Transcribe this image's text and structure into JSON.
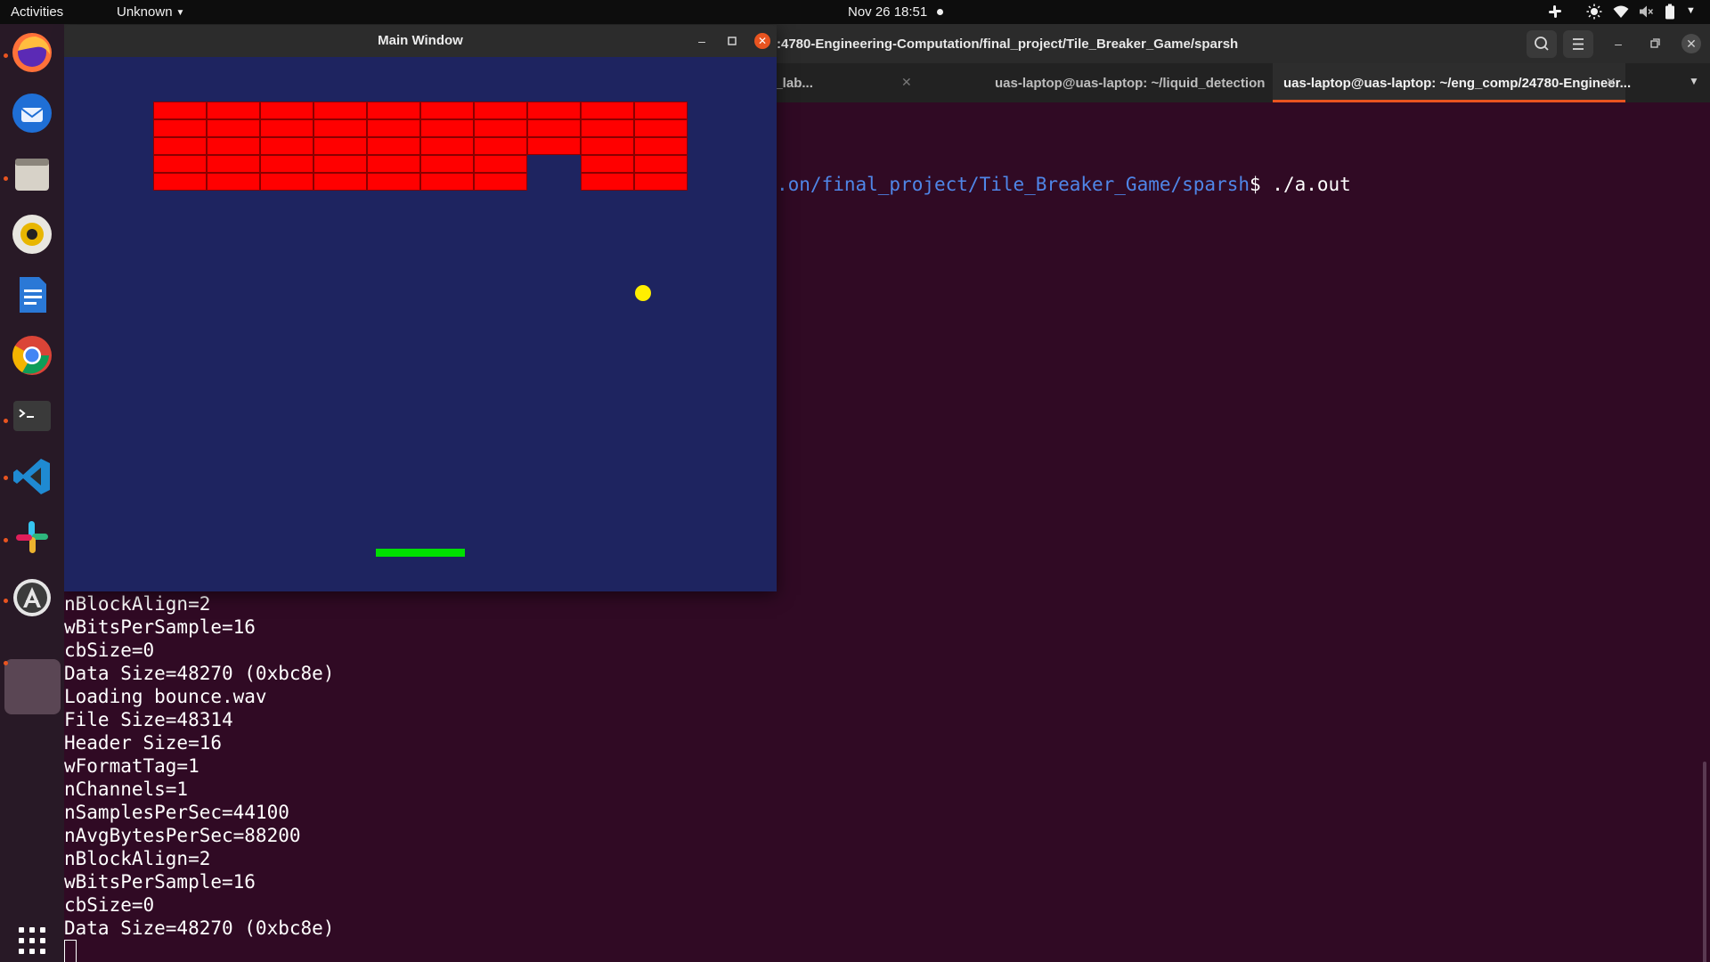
{
  "topbar": {
    "activities": "Activities",
    "app_menu": "Unknown",
    "clock": "Nov 26  18:51"
  },
  "dock": {
    "apps": [
      "firefox",
      "thunderbird",
      "files",
      "rhythmbox",
      "libreoffice-writer",
      "chrome",
      "terminal",
      "vscode",
      "slack",
      "software-updater",
      "active-window"
    ],
    "running": [
      "firefox",
      "files",
      "terminal",
      "vscode",
      "slack",
      "software-updater",
      "active-window"
    ],
    "accent": "#e95420"
  },
  "terminal": {
    "title": ":4780-Engineering-Computation/final_project/Tile_Breaker_Game/sparsh",
    "tabs": [
      {
        "label": "a_lab...",
        "active": false
      },
      {
        "label": "uas-laptop@uas-laptop: ~/liquid_detection",
        "active": false
      },
      {
        "label": "uas-laptop@uas-laptop: ~/eng_comp/24780-Engineer...",
        "active": true
      }
    ],
    "prompt_path": ".on/final_project/Tile_Breaker_Game/sparsh",
    "prompt_cmd": "$ ./a.out",
    "output": [
      "nBlockAlign=2",
      "wBitsPerSample=16",
      "cbSize=0",
      "Data Size=48270 (0xbc8e)",
      "Loading bounce.wav",
      "File Size=48314",
      "Header Size=16",
      "wFormatTag=1",
      "nChannels=1",
      "nSamplesPerSec=44100",
      "nAvgBytesPerSec=88200",
      "nBlockAlign=2",
      "wBitsPerSample=16",
      "cbSize=0",
      "Data Size=48270 (0xbc8e)"
    ],
    "background": "#300a24"
  },
  "game": {
    "title": "Main Window",
    "brick_grid": {
      "columns": 10,
      "rows": 5,
      "missing": [
        [
          3,
          7
        ],
        [
          4,
          7
        ]
      ]
    },
    "colors": {
      "background": "#1e2460",
      "brick": "#ff0000",
      "ball": "#ffee00",
      "paddle": "#00e000"
    }
  }
}
